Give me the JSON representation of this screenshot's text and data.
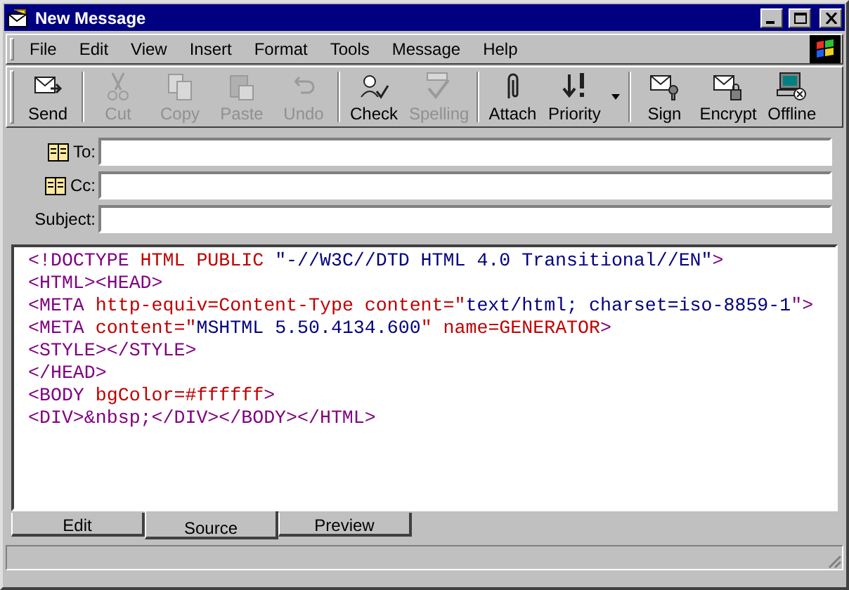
{
  "window": {
    "title": "New Message"
  },
  "menu": [
    "File",
    "Edit",
    "View",
    "Insert",
    "Format",
    "Tools",
    "Message",
    "Help"
  ],
  "toolbar": [
    [
      {
        "label": "Send",
        "kind": "send",
        "disabled": false
      }
    ],
    [
      {
        "label": "Cut",
        "kind": "cut",
        "disabled": true
      },
      {
        "label": "Copy",
        "kind": "copy",
        "disabled": true
      },
      {
        "label": "Paste",
        "kind": "paste",
        "disabled": true
      },
      {
        "label": "Undo",
        "kind": "undo",
        "disabled": true
      }
    ],
    [
      {
        "label": "Check",
        "kind": "check",
        "disabled": false
      },
      {
        "label": "Spelling",
        "kind": "spelling",
        "disabled": true
      }
    ],
    [
      {
        "label": "Attach",
        "kind": "attach",
        "disabled": false
      },
      {
        "label": "Priority",
        "kind": "priority",
        "disabled": false
      }
    ],
    [
      {
        "label": "Sign",
        "kind": "sign",
        "disabled": false
      },
      {
        "label": "Encrypt",
        "kind": "encrypt",
        "disabled": false
      },
      {
        "label": "Offline",
        "kind": "offline",
        "disabled": false
      }
    ]
  ],
  "fields": [
    {
      "label": "To:",
      "kind": "address"
    },
    {
      "label": "Cc:",
      "kind": "address"
    },
    {
      "label": "Subject:",
      "kind": "plain"
    }
  ],
  "source": [
    [
      {
        "text": "<!DOCTYPE ",
        "color": "#800080"
      },
      {
        "text": "HTML PUBLIC ",
        "color": "#c00000"
      },
      {
        "text": "\"-//W3C//DTD HTML 4.0 Transitional//EN\"",
        "color": "#000080"
      },
      {
        "text": ">",
        "color": "#800080"
      }
    ],
    [
      {
        "text": "<HTML><HEAD>",
        "color": "#800080"
      }
    ],
    [
      {
        "text": "<META ",
        "color": "#800080"
      },
      {
        "text": "http-equiv=Content-Type content=\"",
        "color": "#c00000"
      },
      {
        "text": "text/html; charset=iso-8859-1",
        "color": "#000080"
      },
      {
        "text": "\">",
        "color": "#800080"
      }
    ],
    [
      {
        "text": "<META ",
        "color": "#800080"
      },
      {
        "text": "content=\"",
        "color": "#c00000"
      },
      {
        "text": "MSHTML 5.50.4134.600",
        "color": "#000080"
      },
      {
        "text": "\" name=GENERATOR",
        "color": "#c00000"
      },
      {
        "text": ">",
        "color": "#800080"
      }
    ],
    [
      {
        "text": "<STYLE></STYLE>",
        "color": "#800080"
      }
    ],
    [
      {
        "text": "</HEAD>",
        "color": "#800080"
      }
    ],
    [
      {
        "text": "<BODY ",
        "color": "#800080"
      },
      {
        "text": "bgColor=#ffffff",
        "color": "#c00000"
      },
      {
        "text": ">",
        "color": "#800080"
      }
    ],
    [
      {
        "text": "<DIV>&nbsp;</DIV></BODY></HTML>",
        "color": "#800080"
      }
    ]
  ],
  "tabs": [
    {
      "label": "Edit",
      "selected": false
    },
    {
      "label": "Source",
      "selected": true
    },
    {
      "label": "Preview",
      "selected": false
    }
  ]
}
